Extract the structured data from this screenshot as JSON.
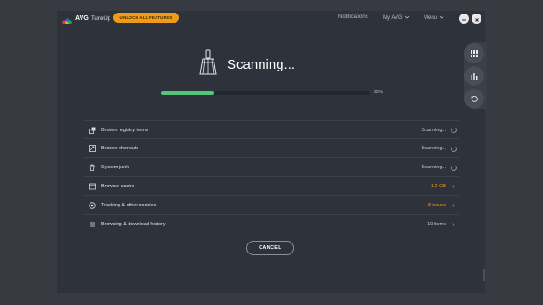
{
  "app": {
    "brand": "AVG",
    "product": "TuneUp"
  },
  "header": {
    "unlock_label": "UNLOCK ALL FEATURES",
    "nav": [
      "Notifications",
      "My AVG",
      "Menu"
    ]
  },
  "scan": {
    "title": "Scanning...",
    "progress_label": "25%",
    "progress_fraction": 0.25
  },
  "items": [
    {
      "label": "Broken registry items",
      "value": "Scanning...",
      "end": "spinner",
      "icon": "registry-icon"
    },
    {
      "label": "Broken shortcuts",
      "value": "Scanning...",
      "end": "spinner",
      "icon": "shortcut-icon"
    },
    {
      "label": "System junk",
      "value": "Scanning...",
      "end": "spinner",
      "icon": "trash-icon"
    },
    {
      "label": "Browser cache",
      "value": "1.2 GB",
      "end": "chevron",
      "icon": "browser-icon"
    },
    {
      "label": "Tracking & other cookies",
      "value": "8 issues",
      "end": "chevron",
      "icon": "tracking-icon"
    },
    {
      "label": "Browsing & download history",
      "value": "10 items",
      "end": "chevron",
      "icon": "history-icon"
    }
  ],
  "cancel_label": "CANCEL",
  "colors": {
    "accent_orange": "#f09a1a",
    "progress_green": "#52c77a",
    "window_bg": "#2d323b"
  }
}
